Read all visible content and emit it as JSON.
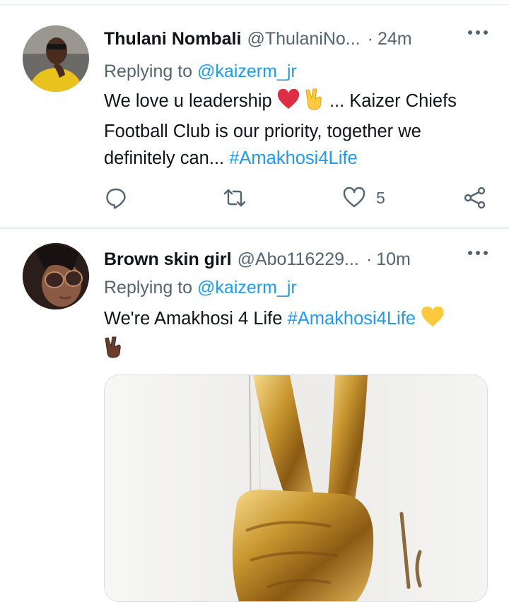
{
  "tweets": [
    {
      "author_name": "Thulani Nombali",
      "handle": "@ThulaniNo...",
      "time": "24m",
      "replying_prefix": "Replying to",
      "replying_to": "@kaizerm_jr",
      "text_before": "We love u leadership",
      "text_after": "... Kaizer Chiefs Football Club is our priority, together we definitely can...",
      "hashtag": "#Amakhosi4Life",
      "like_count": "5"
    },
    {
      "author_name": "Brown skin girl",
      "handle": "@Abo116229...",
      "time": "10m",
      "replying_prefix": "Replying to",
      "replying_to": "@kaizerm_jr",
      "text_before": "We're Amakhosi 4 Life",
      "hashtag": "#Amakhosi4Life"
    }
  ],
  "icons": {
    "accent": "#1d9bf0",
    "secondary": "#536471",
    "reply": "comment-icon",
    "retweet": "retweet-icon",
    "like": "heart-icon",
    "share": "share-icon"
  }
}
